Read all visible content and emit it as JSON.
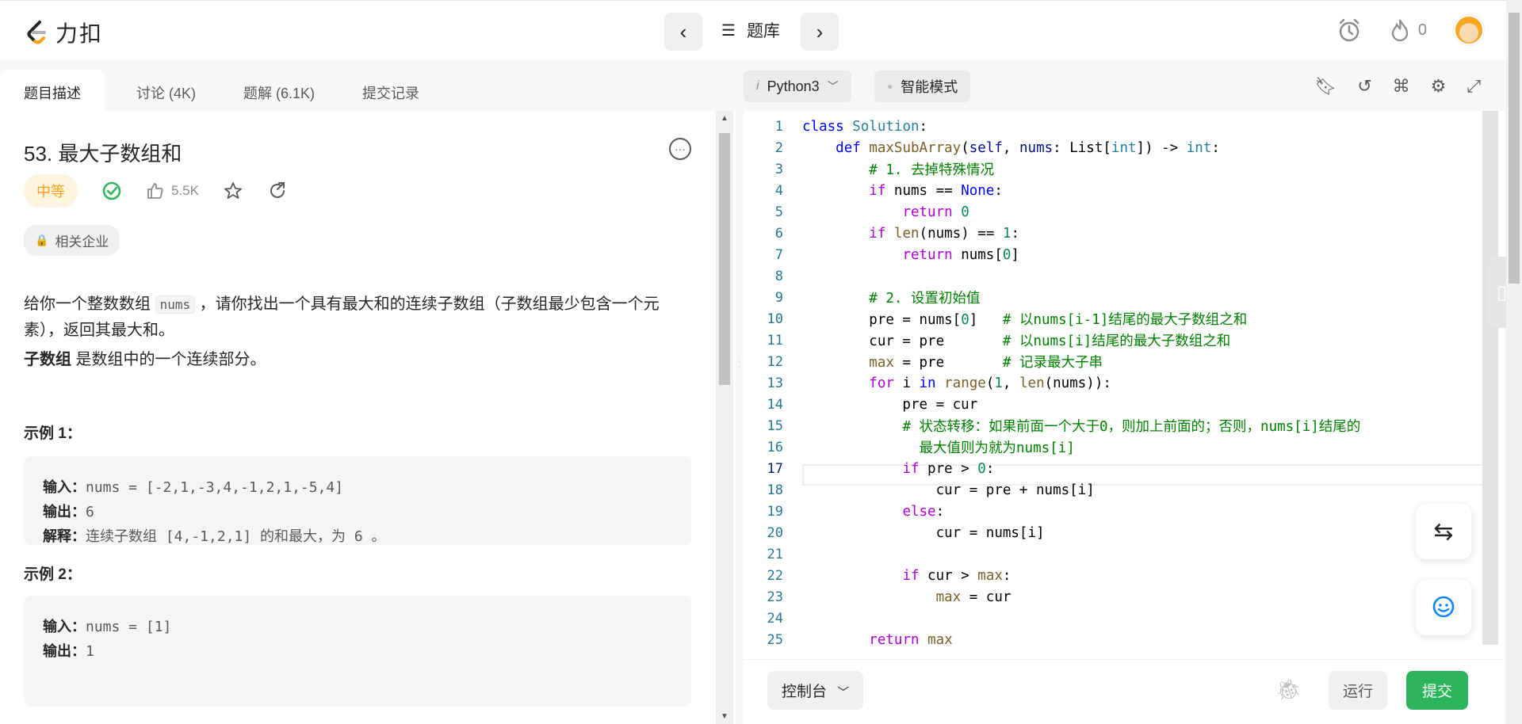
{
  "app": {
    "logo_text": "力扣",
    "brand_color": "#ffa116"
  },
  "header": {
    "prev_label": "‹",
    "next_label": "›",
    "problem_list_label": "题库",
    "streak_count": "0"
  },
  "tabs": [
    {
      "label": "题目描述"
    },
    {
      "label": "讨论 (4K)"
    },
    {
      "label": "题解 (6.1K)"
    },
    {
      "label": "提交记录"
    }
  ],
  "problem": {
    "title": "53. 最大子数组和",
    "difficulty": "中等",
    "likes": "5.5K",
    "company_tag": "相关企业",
    "desc_part1": "给你一个整数数组 ",
    "desc_code": "nums",
    "desc_part2": " ，请你找出一个具有最大和的连续子数组（子数组最少包含一个元素），返回其最大和。",
    "subarray_term": "子数组",
    "subarray_def": " 是数组中的一个连续部分。",
    "examples": [
      {
        "heading": "示例 1：",
        "input_label": "输入：",
        "input": "nums = [-2,1,-3,4,-1,2,1,-5,4]",
        "output_label": "输出：",
        "output": "6",
        "explain_label": "解释：",
        "explain": "连续子数组 [4,-1,2,1] 的和最大，为 6 。"
      },
      {
        "heading": "示例 2：",
        "input_label": "输入：",
        "input": "nums = [1]",
        "output_label": "输出：",
        "output": "1"
      }
    ]
  },
  "editor": {
    "language": "Python3",
    "mode": "智能模式",
    "current_line": 17,
    "line_numbers": [
      "1",
      "2",
      "3",
      "4",
      "5",
      "6",
      "7",
      "8",
      "9",
      "10",
      "11",
      "12",
      "13",
      "14",
      "15",
      "16",
      "17",
      "18",
      "19",
      "20",
      "21",
      "22",
      "23",
      "24",
      "25"
    ]
  },
  "bottom_bar": {
    "console_label": "控制台",
    "run_label": "运行",
    "submit_label": "提交"
  }
}
